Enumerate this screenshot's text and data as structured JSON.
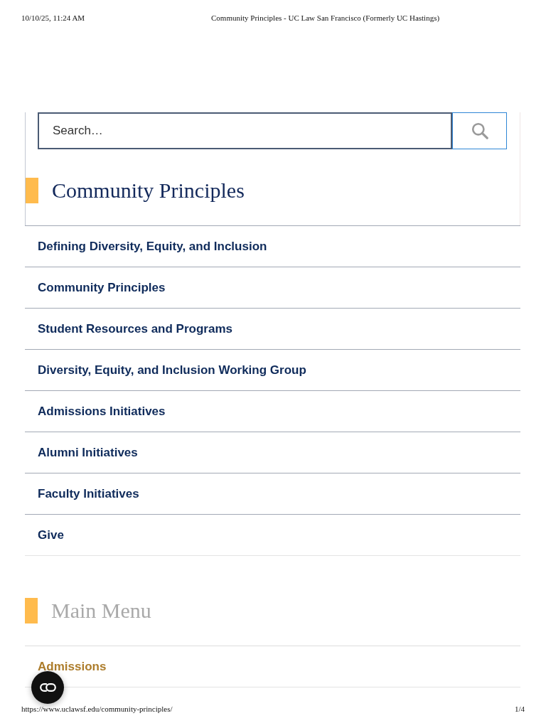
{
  "print_header": {
    "date": "10/10/25, 11:24 AM",
    "title": "Community Principles - UC Law San Francisco (Formerly UC Hastings)"
  },
  "search": {
    "placeholder": "Search…"
  },
  "sections": [
    {
      "title": "Community Principles",
      "active": true,
      "items": [
        "Defining Diversity, Equity, and Inclusion",
        "Community Principles",
        "Student Resources and Programs",
        "Diversity, Equity, and Inclusion Working Group",
        "Admissions Initiatives",
        "Alumni Initiatives",
        "Faculty Initiatives",
        "Give"
      ]
    },
    {
      "title": "Main Menu",
      "active": false,
      "items": [
        "Admissions"
      ]
    }
  ],
  "print_footer": {
    "url": "https://www.uclawsf.edu/community-principles/",
    "page": "1/4"
  }
}
